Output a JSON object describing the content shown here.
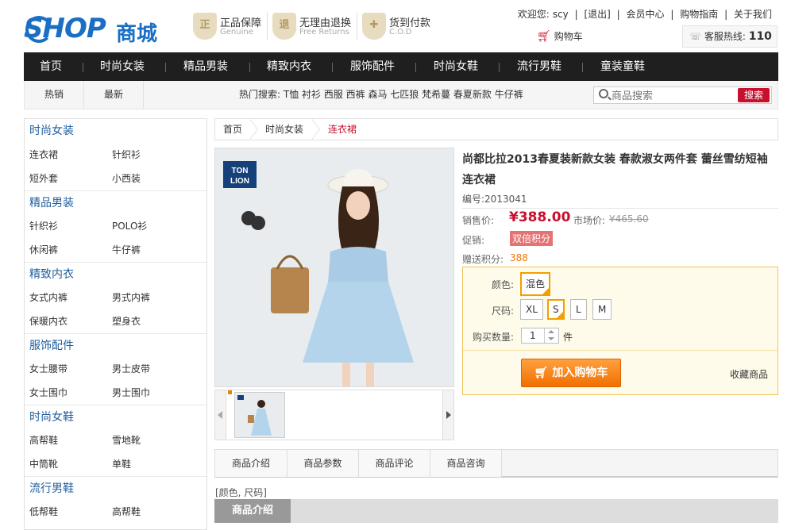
{
  "header": {
    "logo_text": "SHOP",
    "logo_cn": "商城",
    "badges": [
      {
        "icon": "genuine-shield-icon",
        "icon_char": "正",
        "title": "正品保障",
        "subtitle": "Genuine"
      },
      {
        "icon": "return-shield-icon",
        "icon_char": "退",
        "title": "无理由退换",
        "subtitle": "Free Returns"
      },
      {
        "icon": "cod-gift-icon",
        "icon_char": "✚",
        "title": "货到付款",
        "subtitle": "C.O.D"
      }
    ],
    "top_links": {
      "welcome": "欢迎您:",
      "user": "scy",
      "logout": "[退出]",
      "member": "会员中心",
      "guide": "购物指南",
      "about": "关于我们"
    },
    "cart_label": "购物车",
    "hotline_label": "客服热线:",
    "hotline_number": "110"
  },
  "nav": {
    "items": [
      "首页",
      "时尚女装",
      "精品男装",
      "精致内衣",
      "服饰配件",
      "时尚女鞋",
      "流行男鞋",
      "童装童鞋"
    ]
  },
  "subnav": {
    "tabs": [
      "热销",
      "最新"
    ],
    "hot_search": "热门搜索: T恤 衬衫 西服 西裤 森马 七匹狼 梵希蔓 春夏新款 牛仔裤",
    "search_placeholder": "商品搜索",
    "search_button": "搜索"
  },
  "sidebar": {
    "categories": [
      {
        "title": "时尚女装",
        "items": [
          "连衣裙",
          "针织衫",
          "短外套",
          "小西装"
        ]
      },
      {
        "title": "精品男装",
        "items": [
          "针织衫",
          "POLO衫",
          "休闲裤",
          "牛仔裤"
        ]
      },
      {
        "title": "精致内衣",
        "items": [
          "女式内裤",
          "男式内裤",
          "保暖内衣",
          "塑身衣"
        ]
      },
      {
        "title": "服饰配件",
        "items": [
          "女士腰带",
          "男士皮带",
          "女士围巾",
          "男士围巾"
        ]
      },
      {
        "title": "时尚女鞋",
        "items": [
          "高帮鞋",
          "雪地靴",
          "中筒靴",
          "单鞋"
        ]
      },
      {
        "title": "流行男鞋",
        "items": [
          "低帮鞋",
          "高帮鞋"
        ]
      }
    ]
  },
  "breadcrumb": [
    "首页",
    "时尚女装",
    "连衣裙"
  ],
  "product": {
    "brand_logo_line1": "TON",
    "brand_logo_line2": "LION",
    "title": "尚都比拉2013春夏装新款女装 春款淑女两件套 蕾丝雪纺短袖连衣裙",
    "code_label": "编号:",
    "code": "2013041",
    "price_label": "销售价:",
    "price": "¥388.00",
    "market_label": "市场价:",
    "market_price": "¥465.60",
    "promo_label": "促销:",
    "promo_tag": "双倍积分",
    "points_label": "赠送积分:",
    "points": "388",
    "color_label": "颜色:",
    "colors": [
      "混色"
    ],
    "selected_color": "混色",
    "size_label": "尺码:",
    "sizes": [
      "XL",
      "S",
      "L",
      "M"
    ],
    "selected_size": "S",
    "qty_label": "购买数量:",
    "qty": "1",
    "qty_unit": "件",
    "add_to_cart": "加入购物车",
    "favorite": "收藏商品"
  },
  "detail_tabs": [
    "商品介绍",
    "商品参数",
    "商品评论",
    "商品咨询"
  ],
  "attr_line": "[颜色, 尺码]",
  "intro_heading": "商品介绍",
  "colors": {
    "accent": "#c8102e",
    "nav_bg": "#1f1f1f",
    "brand_blue": "#1a6fc4",
    "cart_orange": "#f07000"
  }
}
